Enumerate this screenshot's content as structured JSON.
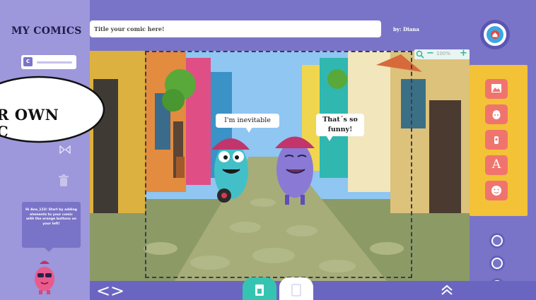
{
  "sidebar": {
    "app_title": "MY COMICS",
    "hint_text": "Hi Ana_123! Start by adding elements to your comic with the orange buttons on your left!"
  },
  "header": {
    "title_placeholder": "Title your comic here!",
    "author": "by: Diana"
  },
  "canvas": {
    "bubble_1": "I'm inevitable",
    "bubble_2_line1": "That´s so",
    "bubble_2_line2": "funny!"
  },
  "zoom": {
    "value": "100%",
    "minus": "−",
    "plus": "+"
  },
  "tools": {
    "text_tool_label": "A"
  },
  "bottom": {
    "prev": "<",
    "next": ">"
  },
  "callout": {
    "text": "R OWN\nC"
  },
  "colors": {
    "sidebar": "#9d97db",
    "background": "#7a74c8",
    "tool_panel": "#f3c237",
    "tool_button": "#f0746e",
    "accent_teal": "#35c4b1",
    "home_blue": "#3ba7e4"
  },
  "icons": [
    "home-icon",
    "image-icon",
    "character-icon",
    "object-icon",
    "text-icon",
    "emoji-icon",
    "eye-icon",
    "save-icon",
    "trash-icon",
    "search-icon",
    "flip-icon",
    "chevron-up-icon"
  ]
}
